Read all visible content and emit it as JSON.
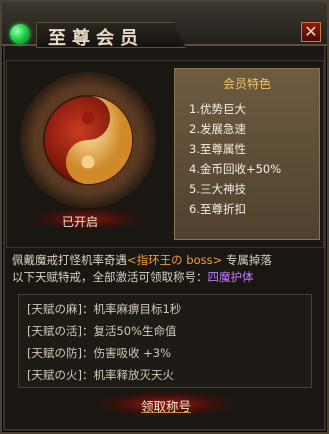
{
  "window": {
    "title": "至尊会员",
    "close_label": "✕"
  },
  "emblem": {
    "status_label": "已开启"
  },
  "features": {
    "title": "会员特色",
    "items": [
      "1.优势巨大",
      "2.发展急速",
      "3.至尊属性",
      "4.金币回收+50%",
      "5.三大神技",
      "6.至尊折扣"
    ]
  },
  "description": {
    "part1": "佩戴魔戒打怪机率奇遇",
    "boss_tag": "<指环王の boss>",
    "part2": "专属掉落",
    "part3": "以下天赋特戒，全部激活可领取称号：",
    "title_name": "四魔护体"
  },
  "talents": [
    "[天赋の麻]：机率麻痹目标1秒",
    "[天赋の活]：复活50%生命值",
    "[天赋の防]：伤害吸收 +3%",
    "[天赋の火]：机率释放灭天火"
  ],
  "actions": {
    "claim_label": "领取称号"
  },
  "colors": {
    "status_orb": "#1fd14a",
    "accent_orange": "#f0a030",
    "accent_purple": "#c07aff",
    "feature_title": "#efc36a"
  }
}
